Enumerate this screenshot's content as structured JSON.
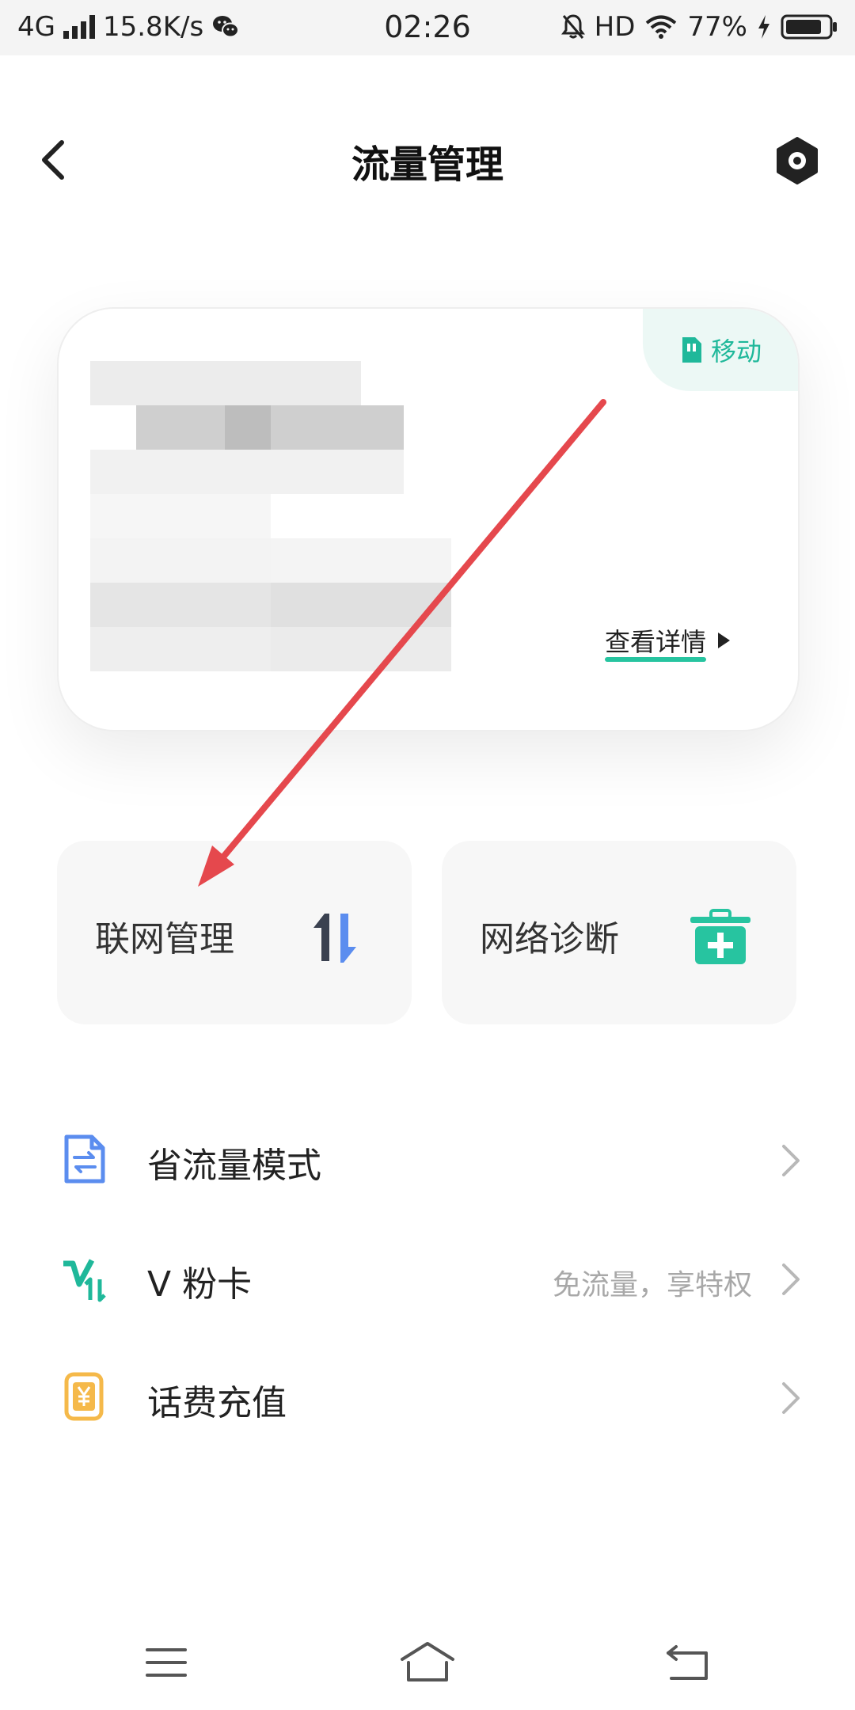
{
  "status_bar": {
    "network": "4G",
    "speed": "15.8K/s",
    "time": "02:26",
    "hd": "HD",
    "battery": "77%"
  },
  "header": {
    "title": "流量管理",
    "back_icon": "back-arrow-icon",
    "settings_icon": "settings-hexagon-icon"
  },
  "card": {
    "carrier": "移动",
    "details_link": "查看详情"
  },
  "tiles": [
    {
      "label": "联网管理",
      "icon": "up-down-arrows-icon"
    },
    {
      "label": "网络诊断",
      "icon": "medical-kit-icon"
    }
  ],
  "list": [
    {
      "label": "省流量模式",
      "sub": "",
      "icon": "document-exchange-icon"
    },
    {
      "label": "V 粉卡",
      "sub": "免流量，享特权",
      "icon": "v-card-logo-icon"
    },
    {
      "label": "话费充值",
      "sub": "",
      "icon": "yuan-card-icon"
    }
  ],
  "colors": {
    "accent": "#27c4a0",
    "carrier_bg": "#ecf8f5",
    "annotation_arrow": "#e5484d",
    "arrow_blue": "#5b8def",
    "arrow_dark": "#3a4150",
    "doc_blue": "#5b8def",
    "yuan_orange": "#f5b94a"
  },
  "nav": [
    "menu-icon",
    "home-icon",
    "back-icon"
  ]
}
